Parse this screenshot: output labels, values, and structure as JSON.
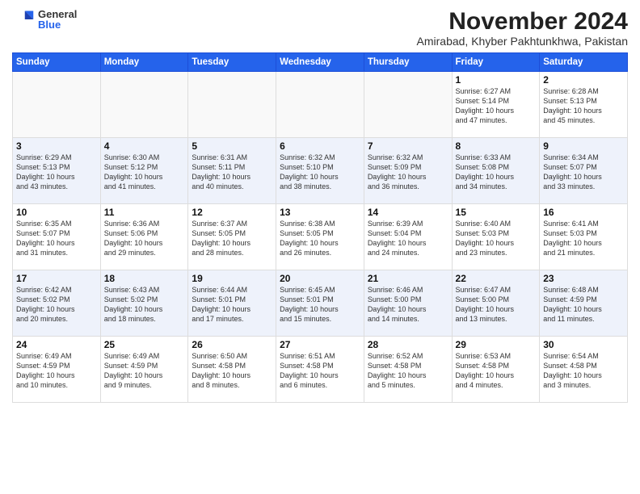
{
  "logo": {
    "general": "General",
    "blue": "Blue"
  },
  "title": "November 2024",
  "subtitle": "Amirabad, Khyber Pakhtunkhwa, Pakistan",
  "weekdays": [
    "Sunday",
    "Monday",
    "Tuesday",
    "Wednesday",
    "Thursday",
    "Friday",
    "Saturday"
  ],
  "weeks": [
    [
      {
        "day": "",
        "info": ""
      },
      {
        "day": "",
        "info": ""
      },
      {
        "day": "",
        "info": ""
      },
      {
        "day": "",
        "info": ""
      },
      {
        "day": "",
        "info": ""
      },
      {
        "day": "1",
        "info": "Sunrise: 6:27 AM\nSunset: 5:14 PM\nDaylight: 10 hours\nand 47 minutes."
      },
      {
        "day": "2",
        "info": "Sunrise: 6:28 AM\nSunset: 5:13 PM\nDaylight: 10 hours\nand 45 minutes."
      }
    ],
    [
      {
        "day": "3",
        "info": "Sunrise: 6:29 AM\nSunset: 5:13 PM\nDaylight: 10 hours\nand 43 minutes."
      },
      {
        "day": "4",
        "info": "Sunrise: 6:30 AM\nSunset: 5:12 PM\nDaylight: 10 hours\nand 41 minutes."
      },
      {
        "day": "5",
        "info": "Sunrise: 6:31 AM\nSunset: 5:11 PM\nDaylight: 10 hours\nand 40 minutes."
      },
      {
        "day": "6",
        "info": "Sunrise: 6:32 AM\nSunset: 5:10 PM\nDaylight: 10 hours\nand 38 minutes."
      },
      {
        "day": "7",
        "info": "Sunrise: 6:32 AM\nSunset: 5:09 PM\nDaylight: 10 hours\nand 36 minutes."
      },
      {
        "day": "8",
        "info": "Sunrise: 6:33 AM\nSunset: 5:08 PM\nDaylight: 10 hours\nand 34 minutes."
      },
      {
        "day": "9",
        "info": "Sunrise: 6:34 AM\nSunset: 5:07 PM\nDaylight: 10 hours\nand 33 minutes."
      }
    ],
    [
      {
        "day": "10",
        "info": "Sunrise: 6:35 AM\nSunset: 5:07 PM\nDaylight: 10 hours\nand 31 minutes."
      },
      {
        "day": "11",
        "info": "Sunrise: 6:36 AM\nSunset: 5:06 PM\nDaylight: 10 hours\nand 29 minutes."
      },
      {
        "day": "12",
        "info": "Sunrise: 6:37 AM\nSunset: 5:05 PM\nDaylight: 10 hours\nand 28 minutes."
      },
      {
        "day": "13",
        "info": "Sunrise: 6:38 AM\nSunset: 5:05 PM\nDaylight: 10 hours\nand 26 minutes."
      },
      {
        "day": "14",
        "info": "Sunrise: 6:39 AM\nSunset: 5:04 PM\nDaylight: 10 hours\nand 24 minutes."
      },
      {
        "day": "15",
        "info": "Sunrise: 6:40 AM\nSunset: 5:03 PM\nDaylight: 10 hours\nand 23 minutes."
      },
      {
        "day": "16",
        "info": "Sunrise: 6:41 AM\nSunset: 5:03 PM\nDaylight: 10 hours\nand 21 minutes."
      }
    ],
    [
      {
        "day": "17",
        "info": "Sunrise: 6:42 AM\nSunset: 5:02 PM\nDaylight: 10 hours\nand 20 minutes."
      },
      {
        "day": "18",
        "info": "Sunrise: 6:43 AM\nSunset: 5:02 PM\nDaylight: 10 hours\nand 18 minutes."
      },
      {
        "day": "19",
        "info": "Sunrise: 6:44 AM\nSunset: 5:01 PM\nDaylight: 10 hours\nand 17 minutes."
      },
      {
        "day": "20",
        "info": "Sunrise: 6:45 AM\nSunset: 5:01 PM\nDaylight: 10 hours\nand 15 minutes."
      },
      {
        "day": "21",
        "info": "Sunrise: 6:46 AM\nSunset: 5:00 PM\nDaylight: 10 hours\nand 14 minutes."
      },
      {
        "day": "22",
        "info": "Sunrise: 6:47 AM\nSunset: 5:00 PM\nDaylight: 10 hours\nand 13 minutes."
      },
      {
        "day": "23",
        "info": "Sunrise: 6:48 AM\nSunset: 4:59 PM\nDaylight: 10 hours\nand 11 minutes."
      }
    ],
    [
      {
        "day": "24",
        "info": "Sunrise: 6:49 AM\nSunset: 4:59 PM\nDaylight: 10 hours\nand 10 minutes."
      },
      {
        "day": "25",
        "info": "Sunrise: 6:49 AM\nSunset: 4:59 PM\nDaylight: 10 hours\nand 9 minutes."
      },
      {
        "day": "26",
        "info": "Sunrise: 6:50 AM\nSunset: 4:58 PM\nDaylight: 10 hours\nand 8 minutes."
      },
      {
        "day": "27",
        "info": "Sunrise: 6:51 AM\nSunset: 4:58 PM\nDaylight: 10 hours\nand 6 minutes."
      },
      {
        "day": "28",
        "info": "Sunrise: 6:52 AM\nSunset: 4:58 PM\nDaylight: 10 hours\nand 5 minutes."
      },
      {
        "day": "29",
        "info": "Sunrise: 6:53 AM\nSunset: 4:58 PM\nDaylight: 10 hours\nand 4 minutes."
      },
      {
        "day": "30",
        "info": "Sunrise: 6:54 AM\nSunset: 4:58 PM\nDaylight: 10 hours\nand 3 minutes."
      }
    ]
  ],
  "colors": {
    "header_bg": "#2563eb",
    "odd_row": "#ffffff",
    "even_row": "#eef2fb"
  }
}
